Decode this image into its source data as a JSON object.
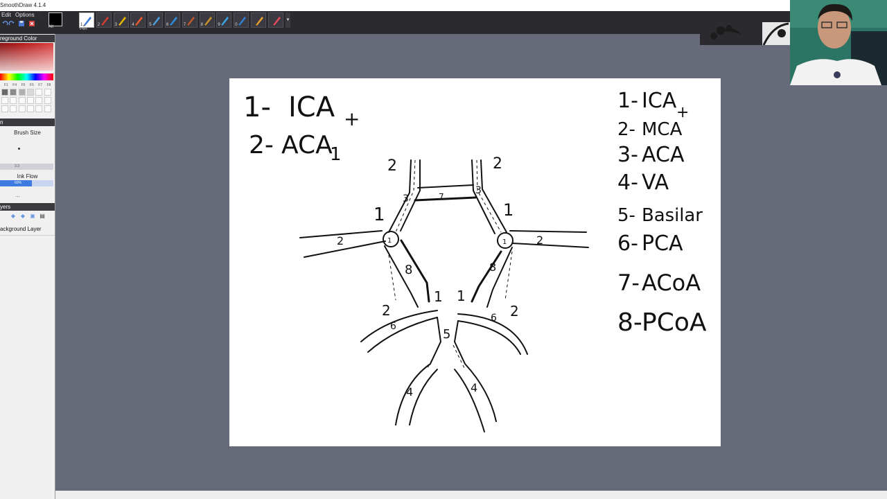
{
  "window": {
    "title": "SmoothDraw 4.1.4"
  },
  "menu": [
    "Edit",
    "Options"
  ],
  "toolbar": {
    "tools": [
      {
        "key": "1",
        "name": "pen-tool",
        "color": "#3a7bd5"
      },
      {
        "key": "2",
        "name": "marker-tool",
        "color": "#d23c2f"
      },
      {
        "key": "3",
        "name": "highlighter-tool",
        "color": "#e8b800"
      },
      {
        "key": "4",
        "name": "pencil-tool",
        "color": "#e85b2d"
      },
      {
        "key": "5",
        "name": "airbrush-tool",
        "color": "#4aa0e0"
      },
      {
        "key": "6",
        "name": "calligraphy-tool",
        "color": "#2d8ee0"
      },
      {
        "key": "7",
        "name": "brush-tool",
        "color": "#c0572c"
      },
      {
        "key": "8",
        "name": "art-brush-tool",
        "color": "#c9922c"
      },
      {
        "key": "9",
        "name": "sprinkle-tool",
        "color": "#3fa4e8"
      },
      {
        "key": "0",
        "name": "water-tool",
        "color": "#3380d0"
      },
      {
        "key": "",
        "name": "hand-tool",
        "color": "#e8a030"
      },
      {
        "key": "",
        "name": "eraser-tool",
        "color": "#e64a5a"
      }
    ],
    "selected_caption": "Pen",
    "swatch_caption": "Alt"
  },
  "panels": {
    "color_header": "reground Color",
    "fkeys": [
      "F1",
      "F4",
      "F5",
      "F6",
      "F7",
      "F8"
    ],
    "brush_header": "n",
    "brush_size_label": "Brush Size",
    "brush_size_value": "3.3",
    "ink_flow_label": "Ink Flow",
    "ink_flow_value": "60%",
    "ink_flow_fraction": 0.6,
    "more": "...",
    "layers_header": "yers",
    "layer_name": "ackground Layer"
  },
  "canvas_text": {
    "top_left": {
      "line1": {
        "num": "1-",
        "abbr": "ICA",
        "sub": "+"
      },
      "line2": {
        "num": "2-",
        "abbr": "ACA",
        "sub": "1"
      }
    },
    "legend": [
      {
        "num": "1-",
        "abbr": "ICA",
        "sub": "+"
      },
      {
        "num": "2-",
        "abbr": "MCA"
      },
      {
        "num": "3-",
        "abbr": "ACA"
      },
      {
        "num": "4-",
        "abbr": "VA"
      },
      {
        "num": "5-",
        "abbr": "Basilar"
      },
      {
        "num": "6-",
        "abbr": "PCA"
      },
      {
        "num": "7-",
        "abbr": "ACoA"
      },
      {
        "num": "8-",
        "abbr": "PCoA"
      }
    ],
    "diagram_labels": [
      "2",
      "2",
      "3",
      "3",
      "1",
      "1",
      "2",
      "2",
      "1",
      "1",
      "8",
      "8",
      "2",
      "2",
      "1",
      "1",
      "6",
      "6",
      "5",
      "4",
      "4",
      "7"
    ]
  }
}
